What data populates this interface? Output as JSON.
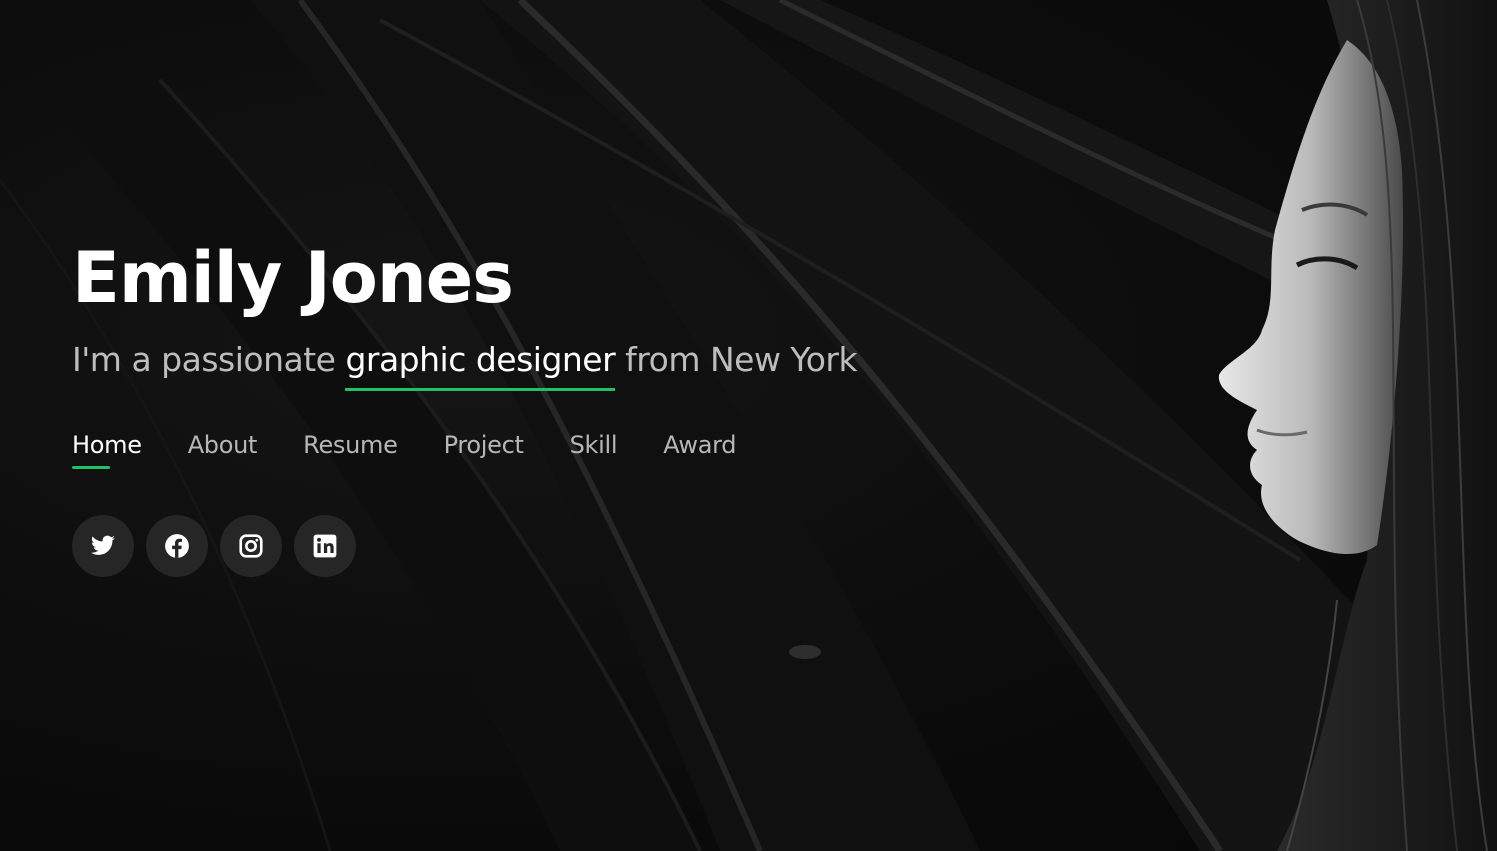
{
  "hero": {
    "name": "Emily Jones",
    "tagline_prefix": "I'm a passionate ",
    "tagline_highlight": "graphic designer",
    "tagline_suffix": " from New York"
  },
  "nav": {
    "items": [
      {
        "label": "Home",
        "active": true
      },
      {
        "label": "About",
        "active": false
      },
      {
        "label": "Resume",
        "active": false
      },
      {
        "label": "Project",
        "active": false
      },
      {
        "label": "Skill",
        "active": false
      },
      {
        "label": "Award",
        "active": false
      }
    ]
  },
  "socials": [
    {
      "icon": "twitter-icon"
    },
    {
      "icon": "facebook-icon"
    },
    {
      "icon": "instagram-icon"
    },
    {
      "icon": "linkedin-icon"
    }
  ],
  "colors": {
    "accent": "#20c065",
    "background": "#0b0b0b",
    "text": "#ffffff",
    "muted": "#bdbdbd",
    "social_bg": "#262626"
  }
}
